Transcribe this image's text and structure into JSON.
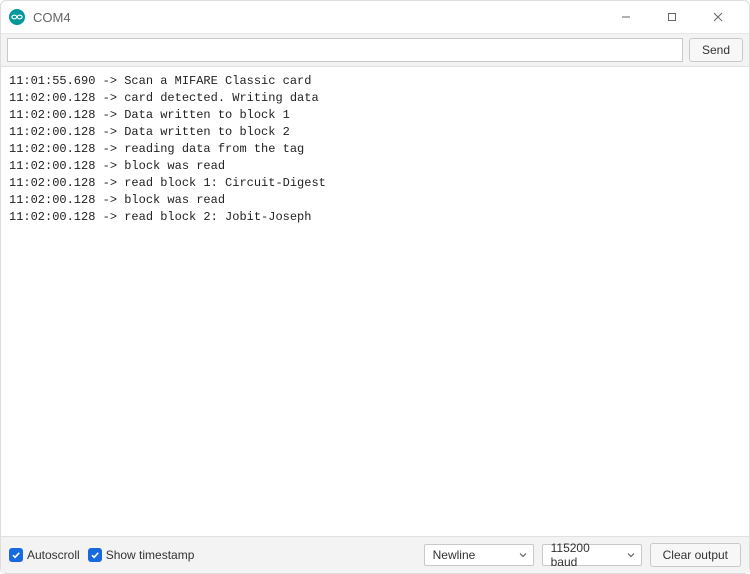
{
  "window": {
    "title": "COM4"
  },
  "toolbar": {
    "input_value": "",
    "input_placeholder": "",
    "send_label": "Send"
  },
  "output": {
    "lines": [
      {
        "ts": "11:01:55.690",
        "arrow": "->",
        "msg": "Scan a MIFARE Classic card"
      },
      {
        "ts": "11:02:00.128",
        "arrow": "->",
        "msg": "card detected. Writing data"
      },
      {
        "ts": "11:02:00.128",
        "arrow": "->",
        "msg": "Data written to block 1"
      },
      {
        "ts": "11:02:00.128",
        "arrow": "->",
        "msg": "Data written to block 2"
      },
      {
        "ts": "11:02:00.128",
        "arrow": "->",
        "msg": "reading data from the tag"
      },
      {
        "ts": "11:02:00.128",
        "arrow": "->",
        "msg": "block was read"
      },
      {
        "ts": "11:02:00.128",
        "arrow": "->",
        "msg": "read block 1: Circuit-Digest"
      },
      {
        "ts": "11:02:00.128",
        "arrow": "->",
        "msg": "block was read"
      },
      {
        "ts": "11:02:00.128",
        "arrow": "->",
        "msg": "read block 2: Jobit-Joseph"
      }
    ]
  },
  "statusbar": {
    "autoscroll_label": "Autoscroll",
    "autoscroll_checked": true,
    "show_timestamp_label": "Show timestamp",
    "show_timestamp_checked": true,
    "line_ending_selected": "Newline",
    "baud_selected": "115200 baud",
    "clear_label": "Clear output"
  },
  "colors": {
    "accent": "#1769e0",
    "arduino_teal": "#00979d"
  },
  "icons": {
    "app": "arduino-infinity-icon",
    "minimize": "minimize-icon",
    "maximize": "maximize-icon",
    "close": "close-icon",
    "check": "check-icon",
    "caret": "chevron-down-icon"
  }
}
